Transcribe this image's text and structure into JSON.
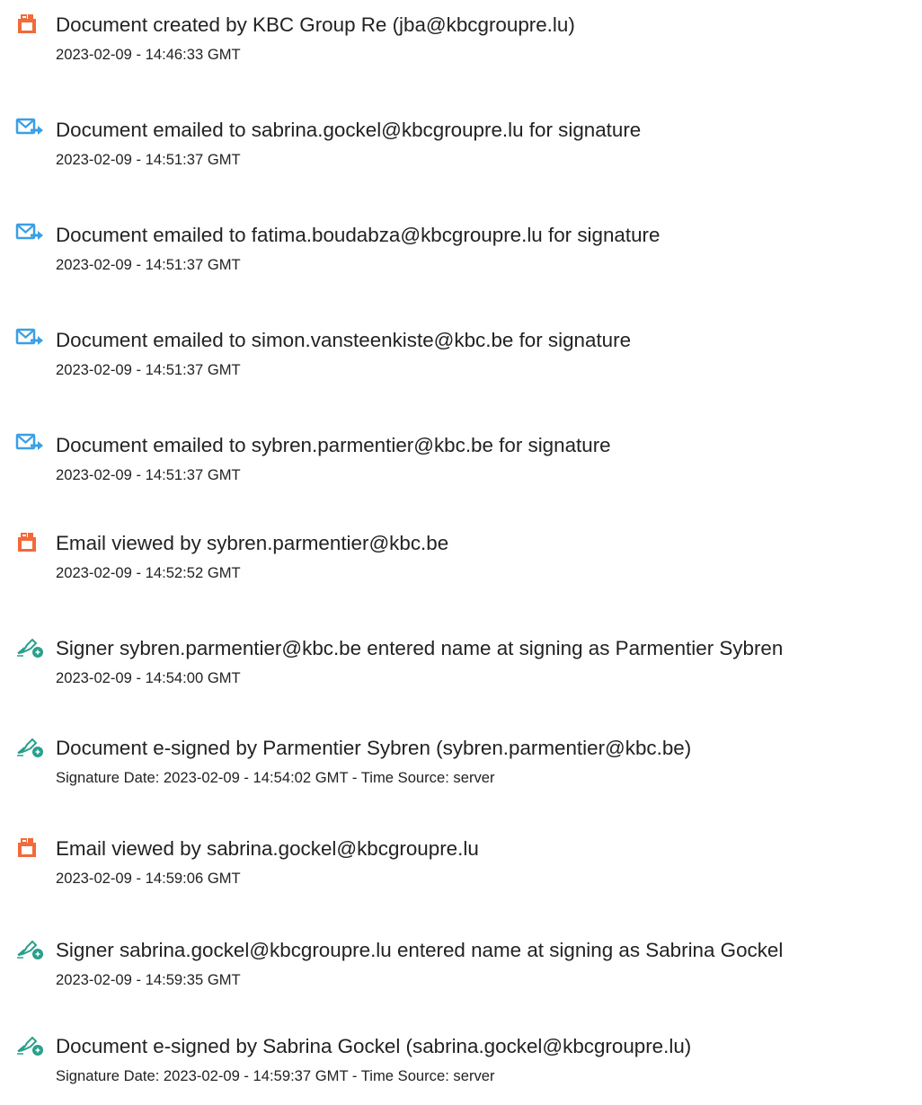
{
  "events": [
    {
      "icon": "document-icon",
      "title": "Document created by KBC Group Re (jba@kbcgroupre.lu)",
      "sub": "2023-02-09 - 14:46:33 GMT"
    },
    {
      "icon": "email-icon",
      "title": "Document emailed to sabrina.gockel@kbcgroupre.lu for signature",
      "sub": "2023-02-09 - 14:51:37 GMT"
    },
    {
      "icon": "email-icon",
      "title": "Document emailed to fatima.boudabza@kbcgroupre.lu for signature",
      "sub": "2023-02-09 - 14:51:37 GMT"
    },
    {
      "icon": "email-icon",
      "title": "Document emailed to simon.vansteenkiste@kbc.be for signature",
      "sub": "2023-02-09 - 14:51:37 GMT"
    },
    {
      "icon": "email-icon",
      "title": "Document emailed to sybren.parmentier@kbc.be for signature",
      "sub": "2023-02-09 - 14:51:37 GMT"
    },
    {
      "icon": "document-icon",
      "title": "Email viewed by sybren.parmentier@kbc.be",
      "sub": "2023-02-09 - 14:52:52 GMT"
    },
    {
      "icon": "pen-icon",
      "title": "Signer sybren.parmentier@kbc.be entered name at signing as Parmentier Sybren",
      "sub": "2023-02-09 - 14:54:00 GMT"
    },
    {
      "icon": "pen-icon",
      "title": "Document e-signed by Parmentier Sybren (sybren.parmentier@kbc.be)",
      "sub": "Signature Date: 2023-02-09 - 14:54:02 GMT - Time Source: server"
    },
    {
      "icon": "document-icon",
      "title": "Email viewed by sabrina.gockel@kbcgroupre.lu",
      "sub": "2023-02-09 - 14:59:06 GMT"
    },
    {
      "icon": "pen-icon",
      "title": "Signer sabrina.gockel@kbcgroupre.lu entered name at signing as Sabrina Gockel",
      "sub": "2023-02-09 - 14:59:35 GMT"
    },
    {
      "icon": "pen-icon",
      "title": "Document e-signed by Sabrina Gockel (sabrina.gockel@kbcgroupre.lu)",
      "sub": "Signature Date: 2023-02-09 - 14:59:37 GMT - Time Source: server"
    }
  ],
  "colors": {
    "document_icon": "#f06a3c",
    "email_icon": "#3b9fe6",
    "pen_icon": "#2aa08c",
    "text": "#222222"
  }
}
